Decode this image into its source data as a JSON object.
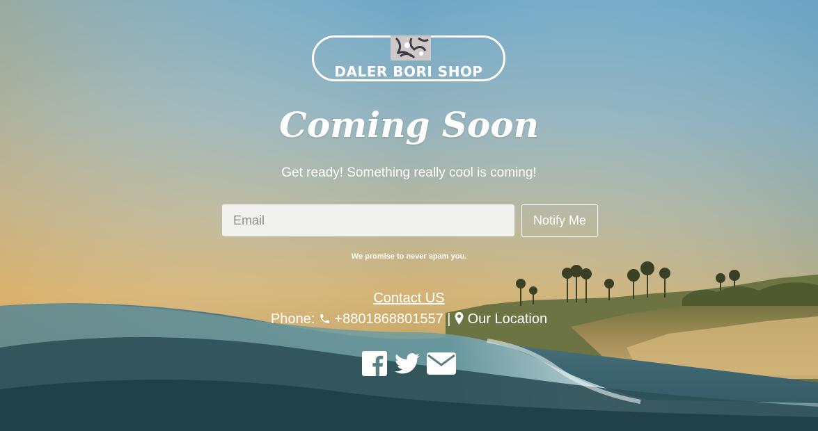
{
  "brand": {
    "logo_text": "DALER BORI SHOP"
  },
  "hero": {
    "title": "Coming Soon",
    "subtitle": "Get ready! Something really cool is coming!"
  },
  "signup": {
    "email_placeholder": "Email",
    "email_value": "",
    "notify_label": "Notify Me",
    "promise_text": "We promise to never spam you."
  },
  "contact": {
    "link_label": "Contact US",
    "phone_prefix": "Phone:",
    "phone_number": "+8801868801557",
    "separator": "|",
    "location_label": "Our Location"
  },
  "icons": {
    "phone": "phone-icon",
    "location": "map-marker-icon",
    "social": [
      "facebook-icon",
      "twitter-icon",
      "envelope-icon"
    ]
  },
  "colors": {
    "text": "#ffffff",
    "input_bg": "#f1f1ef",
    "placeholder": "#8d8d8d"
  }
}
